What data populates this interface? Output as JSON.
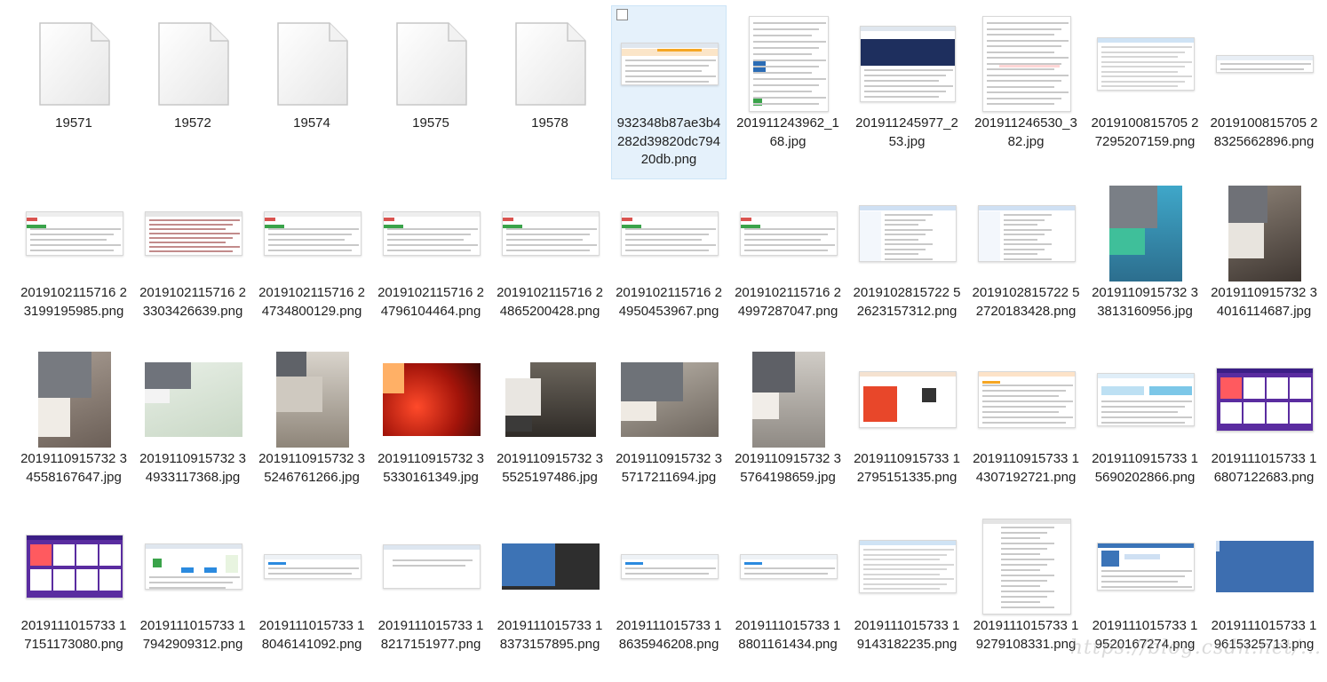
{
  "window": {
    "view": "large-icons",
    "selected_index": 5
  },
  "files": [
    {
      "name": "19571",
      "thumb": "generic-file-icon"
    },
    {
      "name": "19572",
      "thumb": "generic-file-icon"
    },
    {
      "name": "19574",
      "thumb": "generic-file-icon"
    },
    {
      "name": "19575",
      "thumb": "generic-file-icon"
    },
    {
      "name": "19578",
      "thumb": "generic-file-icon"
    },
    {
      "name": "932348b87ae3b4282d39820dc79420db.png",
      "thumb": "ui-screenshot-orange-banner",
      "selected": true
    },
    {
      "name": "201911243962_168.jpg",
      "thumb": "mobile-article-screenshot"
    },
    {
      "name": "201911245977_253.jpg",
      "thumb": "navy-web-page"
    },
    {
      "name": "201911246530_382.jpg",
      "thumb": "text-document"
    },
    {
      "name": "2019100815705 27295207159.png",
      "thumb": "spreadsheet-table"
    },
    {
      "name": "2019100815705 28325662896.png",
      "thumb": "wide-table-strip"
    },
    {
      "name": "2019102115716 23199195985.png",
      "thumb": "admin-green-table"
    },
    {
      "name": "2019102115716 23303426639.png",
      "thumb": "code-editor"
    },
    {
      "name": "2019102115716 24734800129.png",
      "thumb": "admin-green-table"
    },
    {
      "name": "2019102115716 24796104464.png",
      "thumb": "admin-green-table"
    },
    {
      "name": "2019102115716 24865200428.png",
      "thumb": "admin-green-table"
    },
    {
      "name": "2019102115716 24950453967.png",
      "thumb": "admin-green-table"
    },
    {
      "name": "2019102115716 24997287047.png",
      "thumb": "admin-green-table"
    },
    {
      "name": "2019102815722 52623157312.png",
      "thumb": "windows-explorer-tree"
    },
    {
      "name": "2019102815722 52720183428.png",
      "thumb": "windows-explorer-tree"
    },
    {
      "name": "2019110915732 33813160956.jpg",
      "thumb": "photo-kitten-cage"
    },
    {
      "name": "2019110915732 34016114687.jpg",
      "thumb": "photo-kitten-held"
    },
    {
      "name": "2019110915732 34558167647.jpg",
      "thumb": "photo-kitten-closeup"
    },
    {
      "name": "2019110915732 34933117368.jpg",
      "thumb": "photo-cat-on-blanket"
    },
    {
      "name": "2019110915732 35246761266.jpg",
      "thumb": "photo-cat-on-stool"
    },
    {
      "name": "2019110915732 35330161349.jpg",
      "thumb": "photo-red-heat-lamp"
    },
    {
      "name": "2019110915732 35525197486.jpg",
      "thumb": "photo-cat-with-sticker"
    },
    {
      "name": "2019110915732 35717211694.jpg",
      "thumb": "photo-cat-lying"
    },
    {
      "name": "2019110915732 35764198659.jpg",
      "thumb": "photo-cat-floor"
    },
    {
      "name": "2019110915733 12795151335.png",
      "thumb": "cloud-promo-page"
    },
    {
      "name": "2019110915733 14307192721.png",
      "thumb": "orange-web-form"
    },
    {
      "name": "2019110915733 15690202866.png",
      "thumb": "pricing-table"
    },
    {
      "name": "2019111015733 16807122683.png",
      "thumb": "purple-promo-grid"
    },
    {
      "name": "2019111015733 17151173080.png",
      "thumb": "purple-promo-grid"
    },
    {
      "name": "2019111015733 17942909312.png",
      "thumb": "flowchart-page"
    },
    {
      "name": "2019111015733 18046141092.png",
      "thumb": "light-web-table"
    },
    {
      "name": "2019111015733 18217151977.png",
      "thumb": "dialog-window"
    },
    {
      "name": "2019111015733 18373157895.png",
      "thumb": "remote-desktop-dark"
    },
    {
      "name": "2019111015733 18635946208.png",
      "thumb": "light-web-table"
    },
    {
      "name": "2019111015733 18801161434.png",
      "thumb": "light-web-table"
    },
    {
      "name": "2019111015733 19143182235.png",
      "thumb": "spreadsheet-table"
    },
    {
      "name": "2019111015733 19279108331.png",
      "thumb": "settings-form-tall"
    },
    {
      "name": "2019111015733 19520167274.png",
      "thumb": "remote-desktop-login-dialog"
    },
    {
      "name": "2019111015733 19615325713.png",
      "thumb": "blue-desktop"
    }
  ],
  "watermark_text": "https://blog.csdn.net/...",
  "colors": {
    "selection_bg": "#e5f1fb",
    "selection_border": "#cce4f7",
    "label_text": "#1f1f1f",
    "accent_orange": "#f5a623",
    "accent_blue": "#2b6cb5",
    "promo_purple": "#5a2ca0"
  }
}
